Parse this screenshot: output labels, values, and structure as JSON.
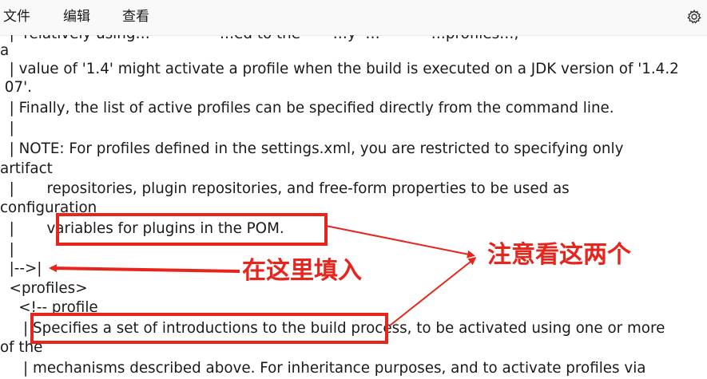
{
  "menubar": {
    "items": [
      "文件",
      "编辑",
      "查看"
    ],
    "settings_icon": "gear-icon"
  },
  "editor": {
    "lines": [
      "  |  relatively using…               …ed to the       …y  …           …profiles…,",
      "a",
      "  | value of '1.4' might activate a profile when the build is executed on a JDK version of '1.4.2",
      " 07'.",
      "  | Finally, the list of active profiles can be specified directly from the command line.",
      "  |",
      "  | NOTE: For profiles defined in the settings.xml, you are restricted to specifying only",
      "artifact",
      "  |       repositories, plugin repositories, and free-form properties to be used as",
      "configuration",
      "  |       variables for plugins in the POM.",
      "  |",
      "  |-->|",
      "  <profiles>",
      "    <!-- profile",
      "     | Specifies a set of introductions to the build process, to be activated using one or more",
      "of the",
      "     | mechanisms described above. For inheritance purposes, and to activate profiles via"
    ]
  },
  "annotations": {
    "fill_here": "在这里填入",
    "note_two": "注意看这两个",
    "color": "#e8251c"
  }
}
